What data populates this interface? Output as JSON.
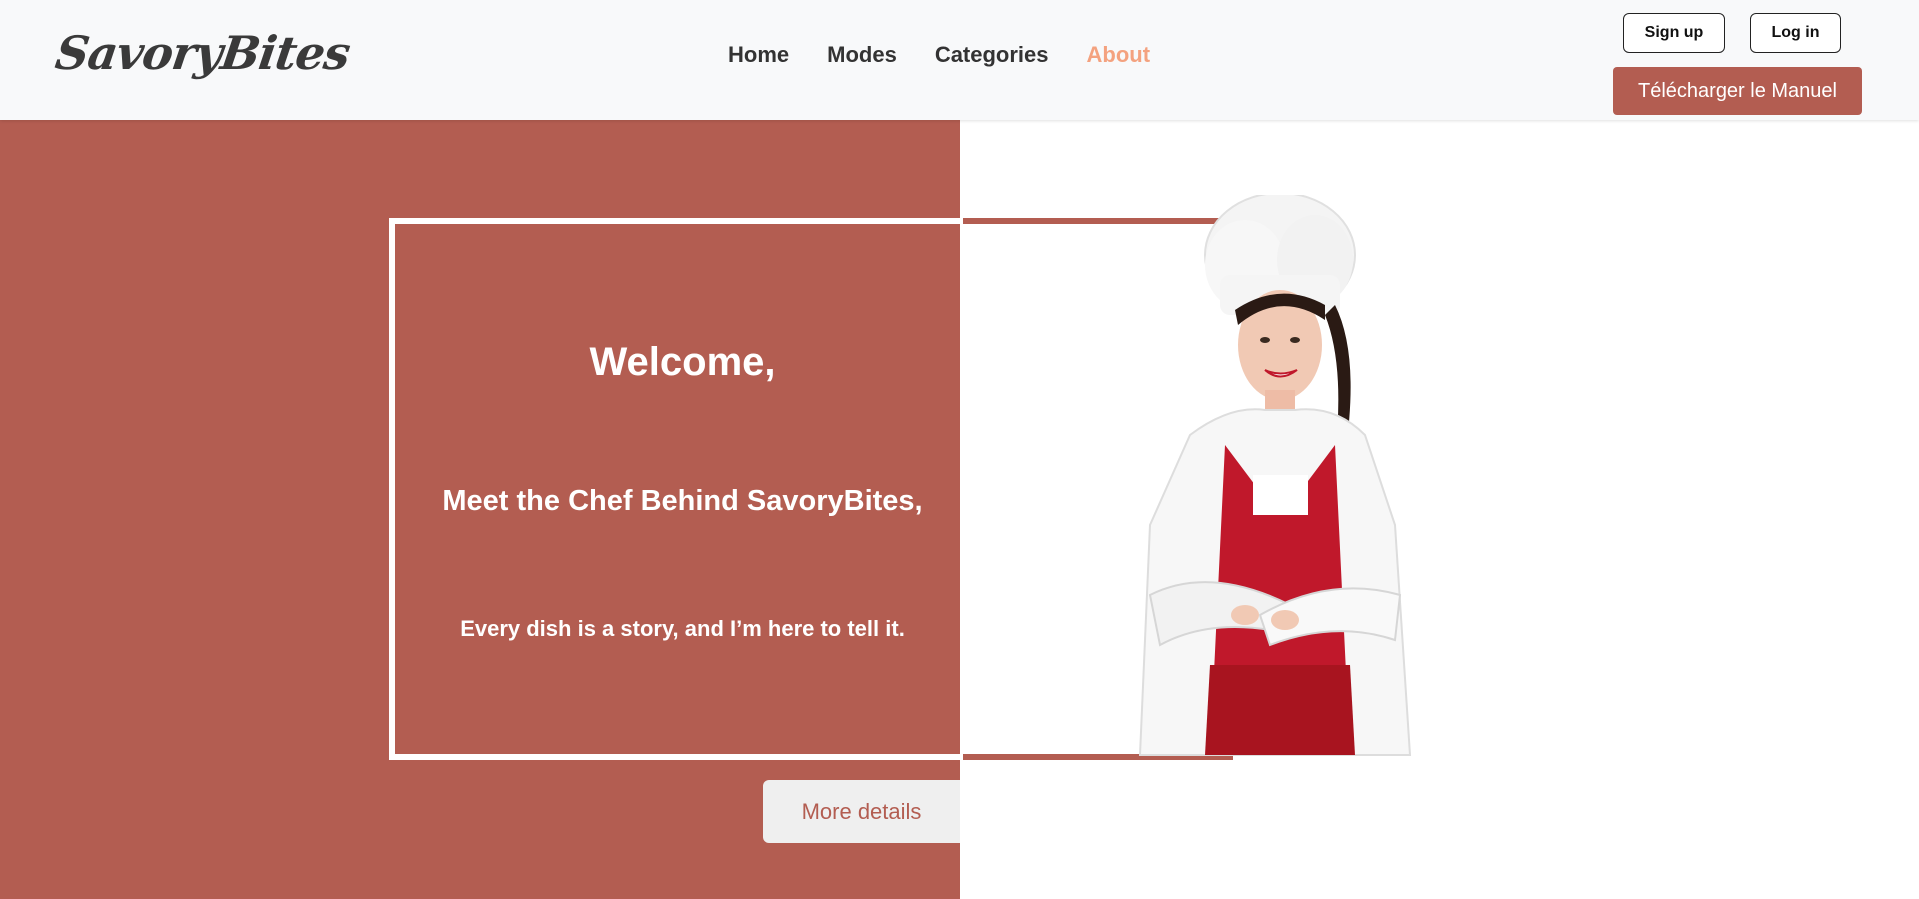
{
  "brand": {
    "logo_text": "SavoryBites"
  },
  "nav": {
    "items": [
      {
        "label": "Home"
      },
      {
        "label": "Modes"
      },
      {
        "label": "Categories"
      },
      {
        "label": "About",
        "active": true
      }
    ]
  },
  "auth": {
    "signup_label": "Sign up",
    "login_label": "Log in"
  },
  "manual_button": {
    "label": "Télécharger le Manuel"
  },
  "hero": {
    "welcome": "Welcome,",
    "headline": "Meet the Chef Behind SavoryBites,",
    "tagline": "Every dish is a story, and I’m here to tell it.",
    "more_button": "More details",
    "image": "chef-portrait"
  },
  "colors": {
    "brand_red": "#b35d51",
    "active_nav": "#f4a27f",
    "header_bg": "#f8f9fa",
    "apron_red": "#c0182b"
  }
}
